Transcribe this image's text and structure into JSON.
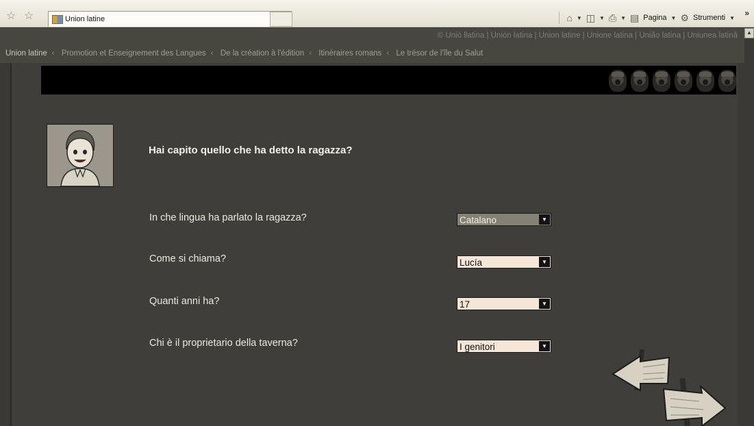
{
  "browser": {
    "tab_title": "Union latine",
    "tools": {
      "page_label": "Pagina",
      "tools_label": "Strumenti"
    }
  },
  "language_bar": "© Unió llatina | Unión latina | Union latine | Unione latina | União latina | Uniunea latină",
  "breadcrumbs": [
    "Union latine",
    "Promotion et Enseignement des Langues",
    "De la création à l'édition",
    "Itinéraires romans",
    "Le trésor de l'île du Salut"
  ],
  "quiz": {
    "title": "Hai capito quello che ha detto la ragazza?",
    "questions": [
      {
        "label": "In che lingua ha parlato la ragazza?",
        "value": "Catalano"
      },
      {
        "label": "Come si chiama?",
        "value": "Lucía"
      },
      {
        "label": "Quanti anni ha?",
        "value": "17"
      },
      {
        "label": "Chi è il proprietario della taverna?",
        "value": "I genitori"
      }
    ]
  },
  "colors": {
    "background": "#3a3936",
    "select_bg": "#f6e6d8",
    "select_active": "#858175",
    "banner": "#000000"
  }
}
